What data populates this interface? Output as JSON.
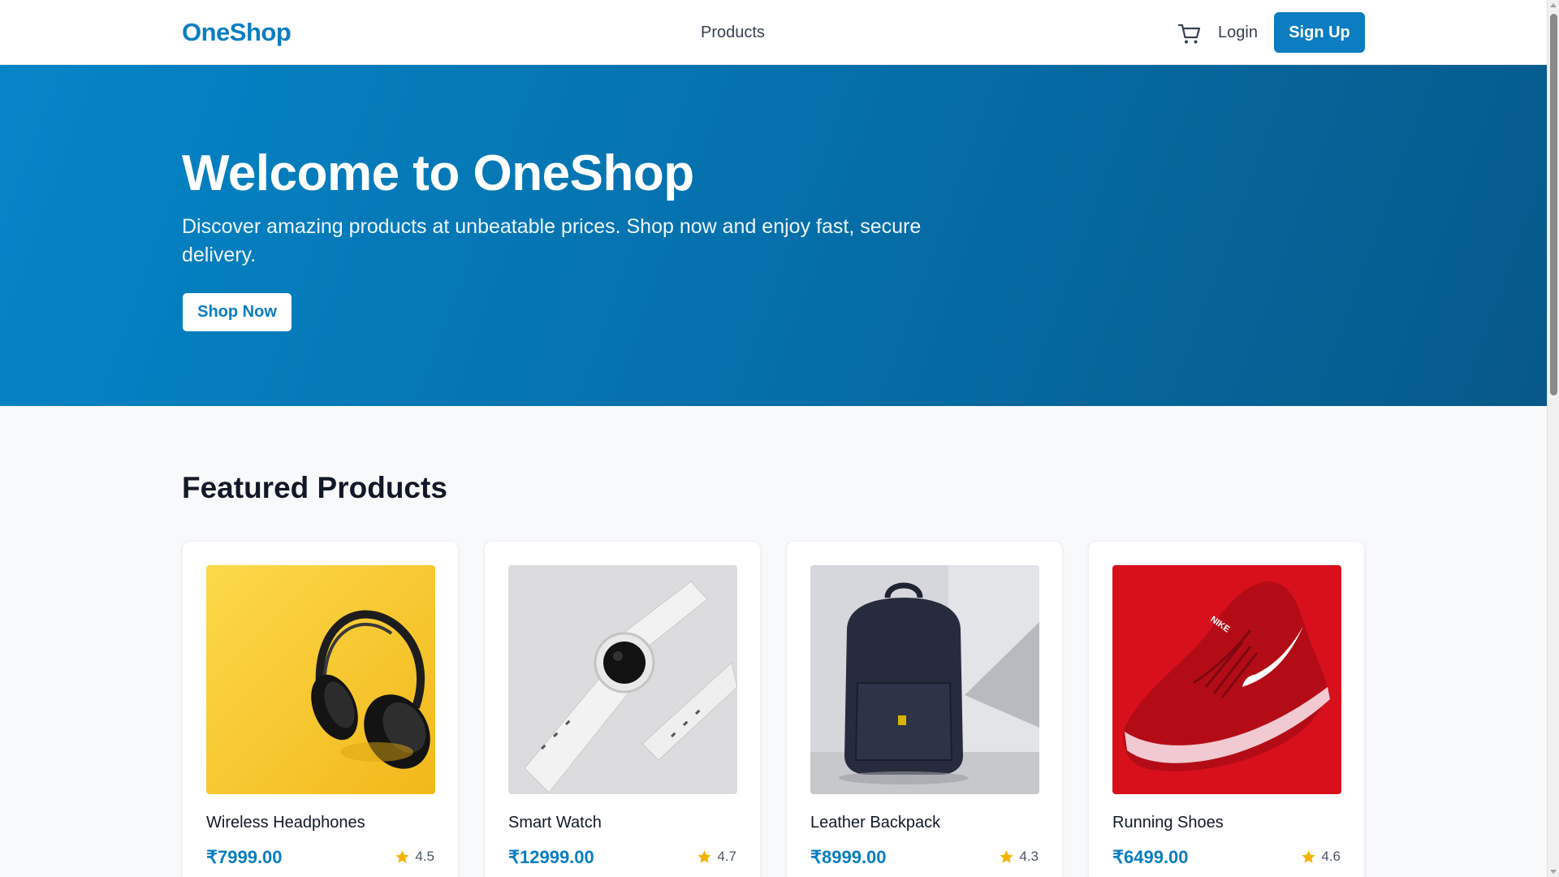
{
  "header": {
    "logo": "OneShop",
    "nav_products": "Products",
    "cart_icon": "cart-icon",
    "login": "Login",
    "signup": "Sign Up"
  },
  "hero": {
    "title": "Welcome to OneShop",
    "subtitle": "Discover amazing products at unbeatable prices. Shop now and enjoy fast, secure delivery.",
    "cta": "Shop Now"
  },
  "featured": {
    "title": "Featured Products",
    "products": [
      {
        "name": "Wireless Headphones",
        "price": "₹7999.00",
        "rating": "4.5",
        "image": "headphones-image"
      },
      {
        "name": "Smart Watch",
        "price": "₹12999.00",
        "rating": "4.7",
        "image": "smartwatch-image"
      },
      {
        "name": "Leather Backpack",
        "price": "₹8999.00",
        "rating": "4.3",
        "image": "backpack-image"
      },
      {
        "name": "Running Shoes",
        "price": "₹6499.00",
        "rating": "4.6",
        "image": "shoe-image"
      }
    ]
  },
  "colors": {
    "brand": "#0b7dc0",
    "hero_start": "#0585c8",
    "hero_end": "#06598a",
    "star": "#f5b301"
  }
}
